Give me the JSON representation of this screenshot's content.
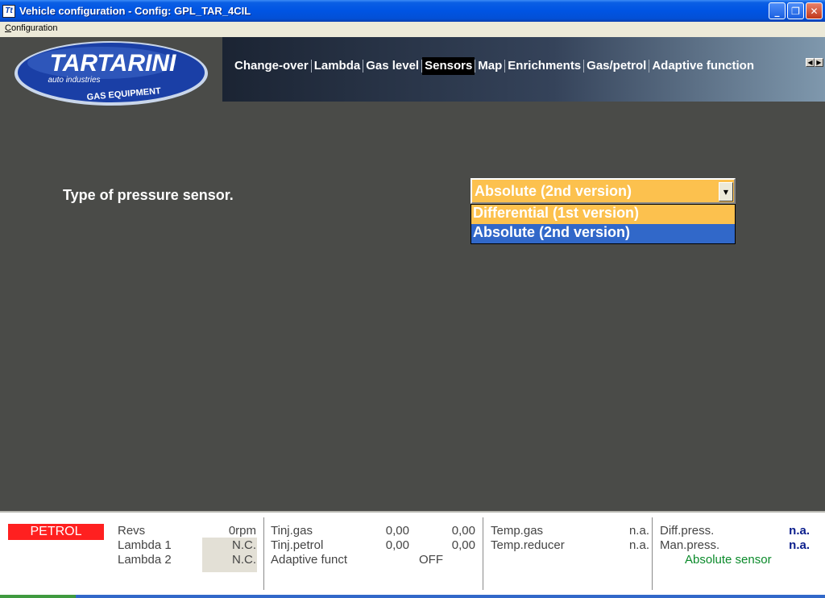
{
  "window": {
    "title": "Vehicle configuration - Config: GPL_TAR_4CIL",
    "minimize_glyph": "_",
    "restore_glyph": "❐",
    "close_glyph": "✕"
  },
  "menu": {
    "configuration_first": "C",
    "configuration_rest": "onfiguration"
  },
  "logo": {
    "brand": "TARTARINI",
    "tagline": "auto industries",
    "sub": "GAS EQUIPMENT"
  },
  "tabs": [
    {
      "label": "Change-over"
    },
    {
      "label": "Lambda"
    },
    {
      "label": "Gas level"
    },
    {
      "label": "Sensors"
    },
    {
      "label": "Map"
    },
    {
      "label": "Enrichments"
    },
    {
      "label": "Gas/petrol"
    },
    {
      "label": "Adaptive function"
    }
  ],
  "active_tab": "Sensors",
  "sensors": {
    "label": "Type of pressure sensor.",
    "selected": "Absolute (2nd version)",
    "options": [
      "Differential (1st version)",
      "Absolute (2nd version)"
    ]
  },
  "status": {
    "fuel_mode": "PETROL",
    "revs_label": "Revs",
    "revs_value": "0rpm",
    "lambda1_label": "Lambda 1",
    "lambda1_value": "N.C.",
    "lambda2_label": "Lambda 2",
    "lambda2_value": "N.C.",
    "tinj_gas_label": "Tinj.gas",
    "tinj_gas_v1": "0,00",
    "tinj_gas_v2": "0,00",
    "tinj_petrol_label": "Tinj.petrol",
    "tinj_petrol_v1": "0,00",
    "tinj_petrol_v2": "0,00",
    "adaptive_label": "Adaptive funct",
    "adaptive_value": "OFF",
    "temp_gas_label": "Temp.gas",
    "temp_gas_value": "n.a.",
    "temp_reducer_label": "Temp.reducer",
    "temp_reducer_value": "n.a.",
    "diff_press_label": "Diff.press.",
    "diff_press_value": "n.a.",
    "man_press_label": "Man.press.",
    "man_press_value": "n.a.",
    "sensor_type": "Absolute sensor"
  },
  "colors": {
    "background": "#4a4b48",
    "combo_fill": "#fcc14e",
    "selection": "#3168c9",
    "petrol_badge": "#ff2020"
  }
}
